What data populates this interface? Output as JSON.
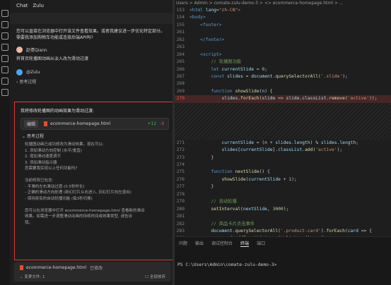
{
  "chat": {
    "header_title": "Chat",
    "header_tab": "Zulu",
    "msg1": "您可以直接在浏览器中打开该文件查看效果。或者我建议进一步优化特定部分。需要我添加购物车功能或连接后端API吗?",
    "user_name": "赵倩Qiann",
    "user_request": "将首页轮播图动画从淡入改为滑动过渡",
    "ai_name": "@Zulu",
    "thinking_label": "思考过程",
    "question": "我将修改轮播图的动画效果为滑动过渡:",
    "file_tag": "编辑",
    "file_name": "ecommerce-homepage.html",
    "added": "+12",
    "removed": "-3",
    "thinking2": "思考过程",
    "bullets": [
      "轮播图动画已成功修改为滑动效果。现在可以:",
      "1. 添加滑动方向控制 (水平/垂直)",
      "2. 增加滑动速度调节",
      "3. 添加滑动指示器",
      "您需要我实现以上任何功能吗?",
      "",
      "当前修改已包含:",
      "- 平滑的左右滑动过渡 (0.5秒时长)",
      "- 正确的滑动方向处理 (新幻灯片从右进入, 旧幻灯片向左退出)",
      "- 保持原有的自动轮播功能 (每3秒切换)",
      "",
      "您可以在浏览器中打开 ecommerce-homepage.html 查看新的滑动",
      "效果。如需进一步调整滑动动画的持续时间或效果类型, 请告诉",
      "我。"
    ],
    "bottom_file": "ecommerce-homepage.html",
    "bottom_state": "已修改",
    "bottom_changes": "变更文件: 1",
    "bottom_action": "全部放弃"
  },
  "editor": {
    "breadcrumb": "Users > Admin > comate-zulu-demo-3 > <> ecommerce-homepage.html > ..."
  },
  "panel": {
    "tabs": [
      "问题",
      "输出",
      "调试控制台",
      "终端",
      "端口"
    ],
    "active_tab": "终端",
    "terminal": "PS C:\\Users\\Admin\\comate-zulu-demo-3>"
  }
}
